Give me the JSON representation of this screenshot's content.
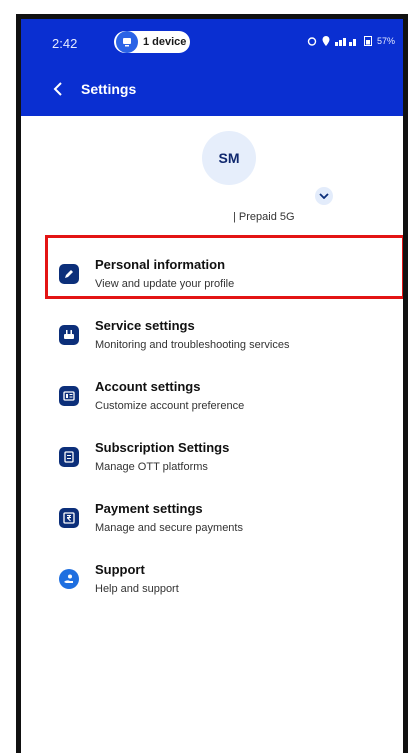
{
  "status_bar": {
    "time": "2:42",
    "device_label": "1 device",
    "battery": "57%"
  },
  "header": {
    "title": "Settings"
  },
  "profile": {
    "initials": "SM",
    "plan": "| Prepaid 5G"
  },
  "menu": [
    {
      "title": "Personal information",
      "subtitle": "View and update your profile",
      "icon": "edit-icon"
    },
    {
      "title": "Service settings",
      "subtitle": "Monitoring and troubleshooting services",
      "icon": "router-icon"
    },
    {
      "title": "Account settings",
      "subtitle": "Customize account preference",
      "icon": "account-card-icon"
    },
    {
      "title": "Subscription Settings",
      "subtitle": "Manage OTT platforms",
      "icon": "subscription-icon"
    },
    {
      "title": "Payment settings",
      "subtitle": "Manage and secure payments",
      "icon": "rupee-icon"
    },
    {
      "title": "Support",
      "subtitle": "Help and support",
      "icon": "support-hand-icon"
    }
  ],
  "colors": {
    "header_bg": "#0a2fd1",
    "icon_bg": "#0c2f7a",
    "highlight": "#e31414"
  }
}
